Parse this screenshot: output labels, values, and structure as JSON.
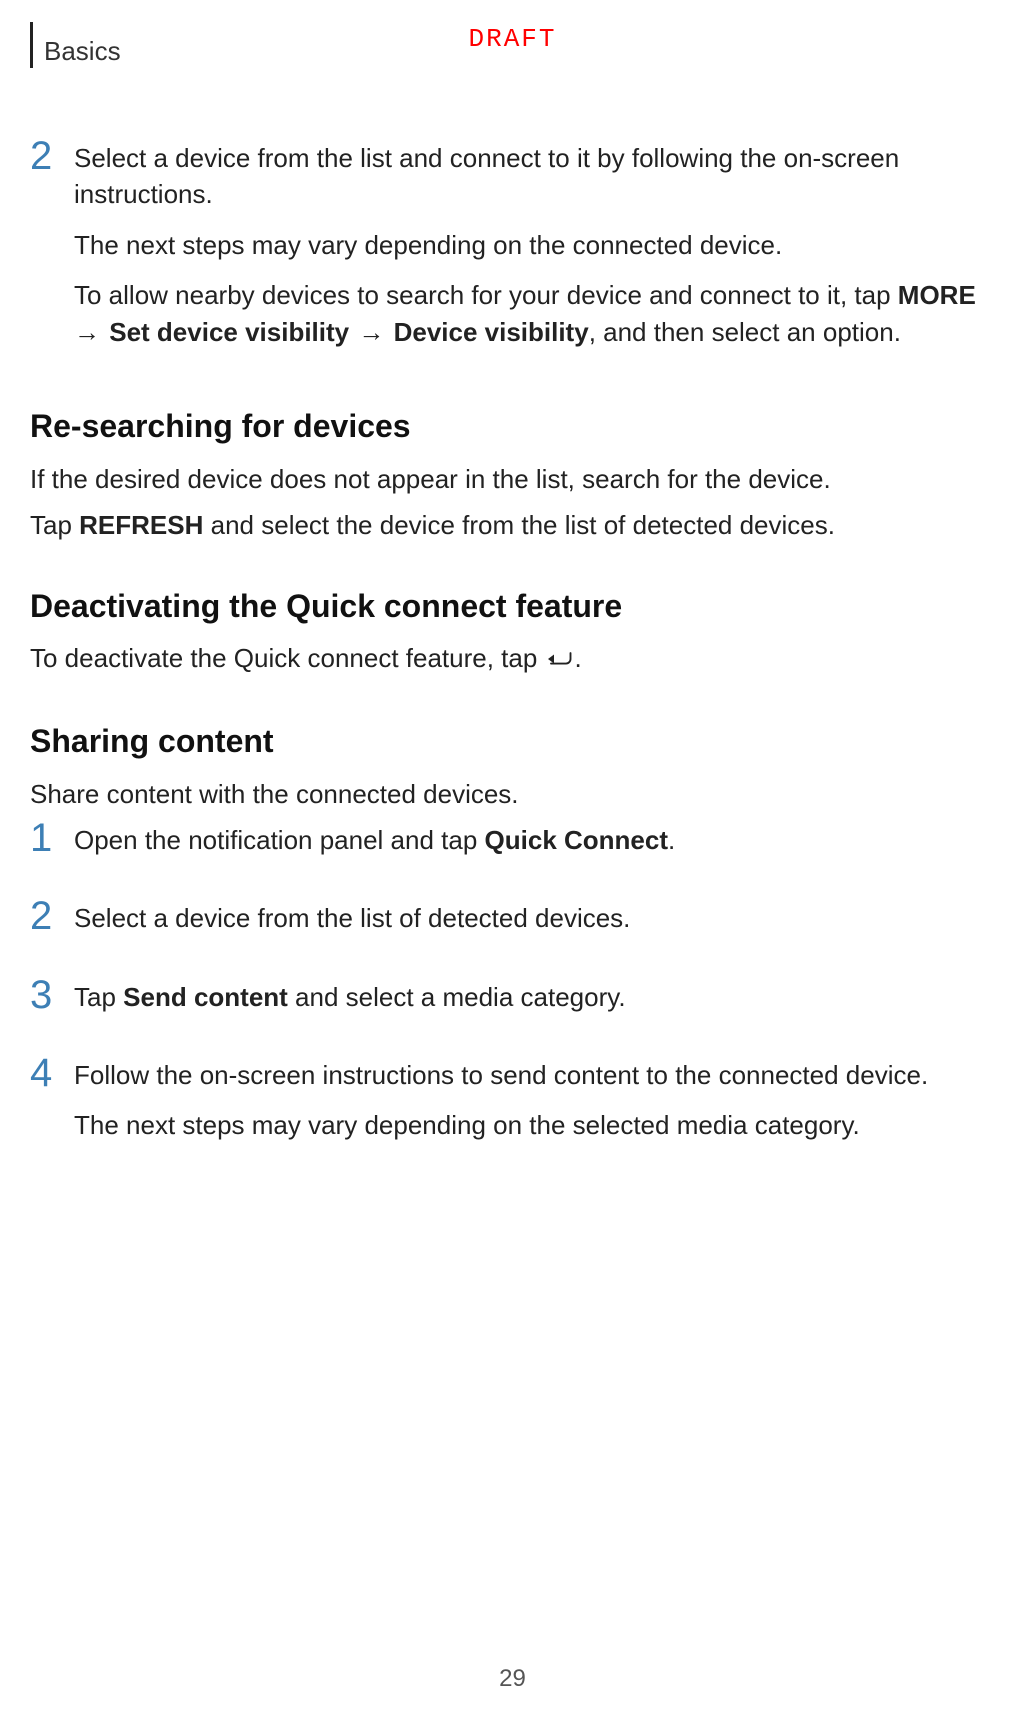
{
  "header": {
    "section": "Basics",
    "watermark": "DRAFT"
  },
  "topStep": {
    "number": "2",
    "line1": "Select a device from the list and connect to it by following the on-screen instructions.",
    "line2": "The next steps may vary depending on the connected device.",
    "line3_pre": "To allow nearby devices to search for your device and connect to it, tap ",
    "line3_bold1": "MORE",
    "arrow": " → ",
    "line3_bold2": "Set device visibility",
    "line3_bold3": "Device visibility",
    "line3_post": ", and then select an option."
  },
  "sec1": {
    "title": "Re-searching for devices",
    "p1": "If the desired device does not appear in the list, search for the device.",
    "p2_pre": "Tap ",
    "p2_bold": "REFRESH",
    "p2_post": " and select the device from the list of detected devices."
  },
  "sec2": {
    "title": "Deactivating the Quick connect feature",
    "p1_pre": "To deactivate the Quick connect feature, tap ",
    "p1_post": "."
  },
  "sec3": {
    "title": "Sharing content",
    "intro": "Share content with the connected devices.",
    "steps": [
      {
        "n": "1",
        "pre": "Open the notification panel and tap ",
        "bold": "Quick Connect",
        "post": "."
      },
      {
        "n": "2",
        "pre": "Select a device from the list of detected devices.",
        "bold": "",
        "post": ""
      },
      {
        "n": "3",
        "pre": "Tap ",
        "bold": "Send content",
        "post": " and select a media category."
      },
      {
        "n": "4",
        "pre": "Follow the on-screen instructions to send content to the connected device.",
        "bold": "",
        "post": "",
        "extra": "The next steps may vary depending on the selected media category."
      }
    ]
  },
  "pageNumber": "29"
}
